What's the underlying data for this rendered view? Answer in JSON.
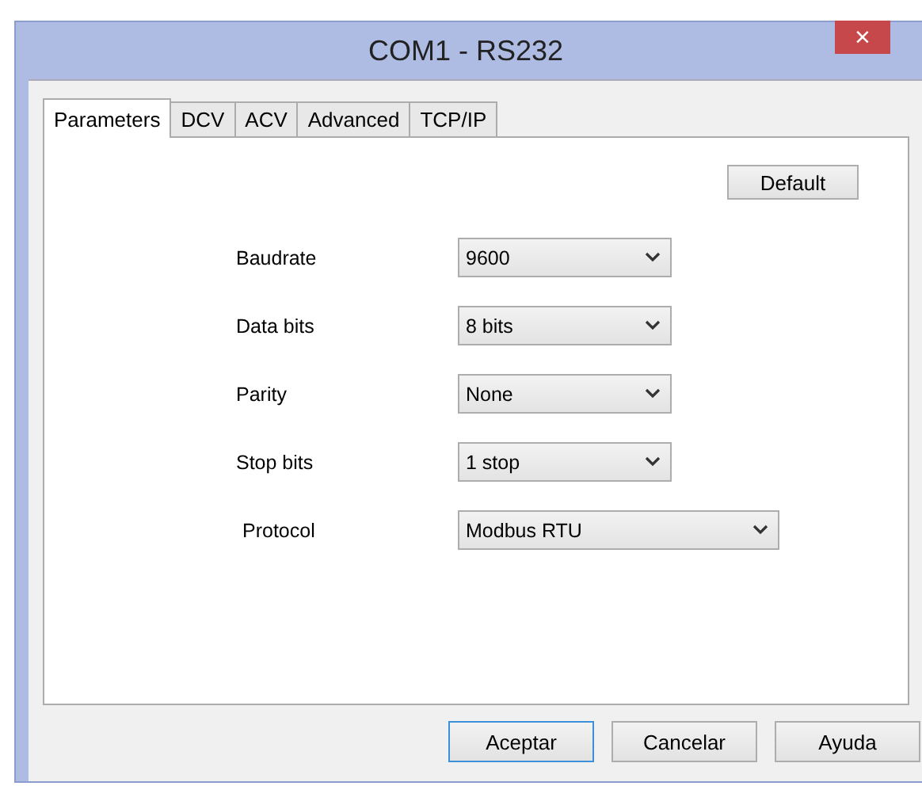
{
  "window": {
    "title": "COM1 - RS232",
    "close": "×"
  },
  "tabs": [
    {
      "label": "Parameters",
      "selected": true
    },
    {
      "label": "DCV",
      "selected": false
    },
    {
      "label": "ACV",
      "selected": false
    },
    {
      "label": "Advanced",
      "selected": false
    },
    {
      "label": "TCP/IP",
      "selected": false
    }
  ],
  "default_button": "Default",
  "fields": [
    {
      "label": "Baudrate",
      "value": "9600",
      "wide": false
    },
    {
      "label": "Data bits",
      "value": "8 bits",
      "wide": false
    },
    {
      "label": "Parity",
      "value": "None",
      "wide": false
    },
    {
      "label": "Stop bits",
      "value": "1 stop",
      "wide": false
    },
    {
      "label": "Protocol",
      "value": "Modbus RTU",
      "wide": true
    }
  ],
  "buttons": [
    {
      "label": "Aceptar",
      "default": true
    },
    {
      "label": "Cancelar",
      "default": false
    },
    {
      "label": "Ayuda",
      "default": false
    }
  ]
}
